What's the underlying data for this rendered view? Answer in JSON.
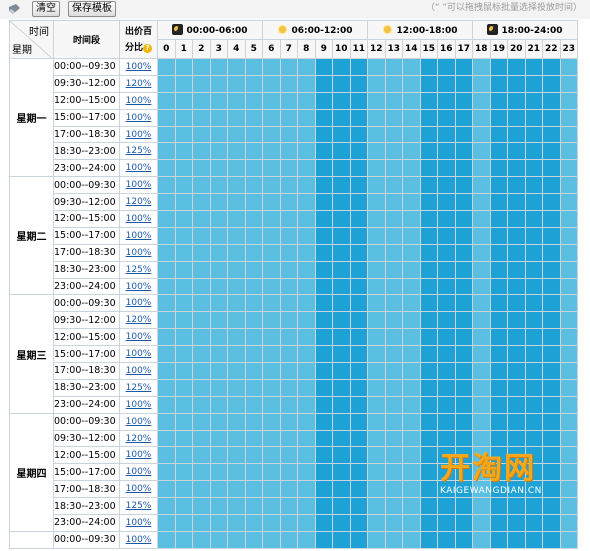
{
  "toolbar": {
    "clear_label": "清空",
    "save_template_label": "保存模板",
    "hint_text": "（“ ”可以拖拽鼠标批量选择投放时间）"
  },
  "header": {
    "time_label": "时间",
    "day_label": "星期",
    "segment_label": "时间段",
    "pct_label_top": "出价百",
    "pct_label_bottom": "分比",
    "quarters": [
      {
        "label": "00:00-06:00",
        "icon": "moon-icon"
      },
      {
        "label": "06:00-12:00",
        "icon": "sun-icon"
      },
      {
        "label": "12:00-18:00",
        "icon": "sun-icon"
      },
      {
        "label": "18:00-24:00",
        "icon": "moon-icon"
      }
    ],
    "hours": [
      "0",
      "1",
      "2",
      "3",
      "4",
      "5",
      "6",
      "7",
      "8",
      "9",
      "10",
      "11",
      "12",
      "13",
      "14",
      "15",
      "16",
      "17",
      "18",
      "19",
      "20",
      "21",
      "22",
      "23"
    ]
  },
  "segments": [
    "00:00--09:30",
    "09:30--12:00",
    "12:00--15:00",
    "15:00--17:00",
    "17:00--18:30",
    "18:30--23:00",
    "23:00--24:00"
  ],
  "days": [
    {
      "name": "星期一",
      "percents": [
        "100%",
        "120%",
        "100%",
        "100%",
        "100%",
        "125%",
        "100%"
      ]
    },
    {
      "name": "星期二",
      "percents": [
        "100%",
        "120%",
        "100%",
        "100%",
        "100%",
        "125%",
        "100%"
      ]
    },
    {
      "name": "星期三",
      "percents": [
        "100%",
        "120%",
        "100%",
        "100%",
        "100%",
        "125%",
        "100%"
      ]
    },
    {
      "name": "星期四",
      "percents": [
        "100%",
        "120%",
        "100%",
        "100%",
        "100%",
        "125%",
        "100%"
      ]
    },
    {
      "name": "",
      "percents": [
        "100%"
      ]
    }
  ],
  "dark_hours": [
    9,
    10,
    11,
    15,
    16,
    17,
    19,
    20,
    21,
    22
  ],
  "colors": {
    "cell_light": "#5bbfe2",
    "cell_dark": "#1ea2d6",
    "link": "#1b59a7"
  },
  "watermark": {
    "main": "开淘网",
    "sub": "KAIGEWANGDIAN.CN"
  }
}
